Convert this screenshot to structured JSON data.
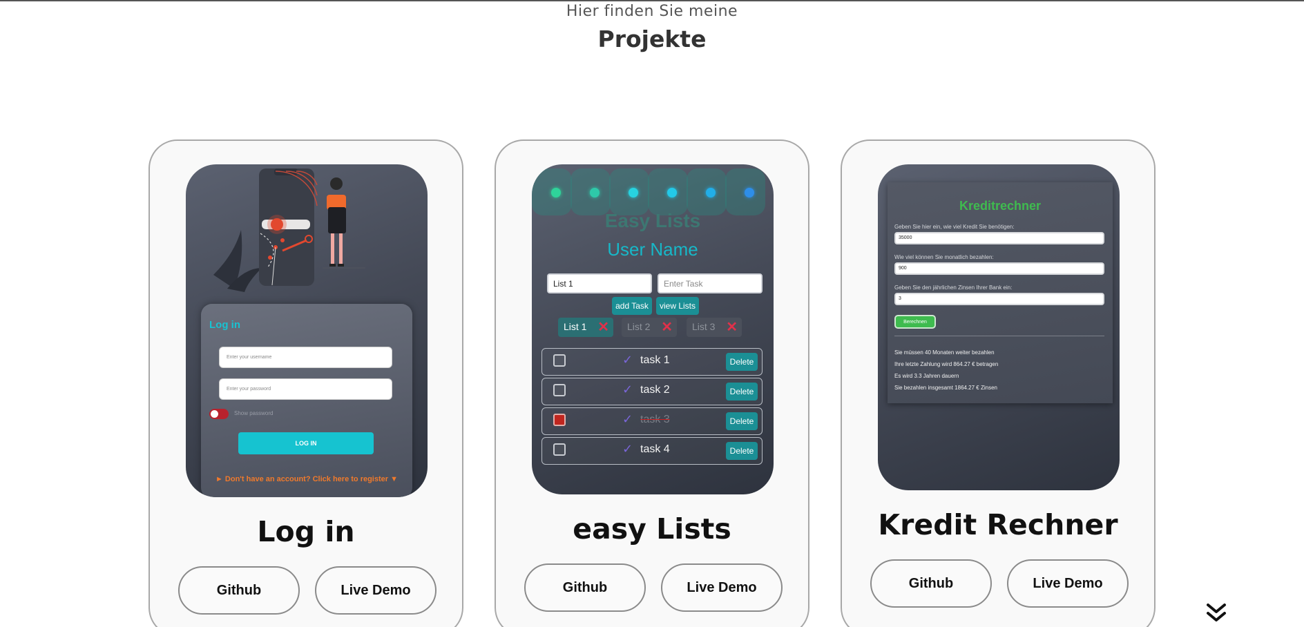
{
  "header": {
    "subtitle": "Hier finden Sie meine",
    "title": "Projekte"
  },
  "projects": [
    {
      "title": "Log in",
      "github_label": "Github",
      "demo_label": "Live Demo",
      "preview": {
        "heading": "Log in",
        "username_placeholder": "Enter your username",
        "password_placeholder": "Enter your password",
        "show_password_label": "Show password",
        "login_button": "LOG IN",
        "register_link": "► Don't have an account? Click here to register ▼"
      }
    },
    {
      "title": "easy Lists",
      "github_label": "Github",
      "demo_label": "Live Demo",
      "preview": {
        "app_title": "Easy Lists",
        "user_name": "User Name",
        "list_input_value": "List 1",
        "task_input_placeholder": "Enter Task",
        "add_task_button": "add Task",
        "view_lists_button": "view Lists",
        "lists": [
          "List 1",
          "List 2",
          "List 3"
        ],
        "tasks": [
          {
            "label": "task 1",
            "checked": false
          },
          {
            "label": "task 2",
            "checked": false
          },
          {
            "label": "task 3",
            "checked": true
          },
          {
            "label": "task 4",
            "checked": false
          }
        ],
        "delete_label": "Delete",
        "dot_colors": [
          "#2fd39a",
          "#2ec9a9",
          "#27d3e0",
          "#23c9e8",
          "#22aee8",
          "#2e8ee8"
        ]
      }
    },
    {
      "title": "Kredit Rechner",
      "github_label": "Github",
      "demo_label": "Live Demo",
      "preview": {
        "app_title": "Kreditrechner",
        "label_amount": "Geben Sie hier ein, wie viel Kredit Sie benötigen:",
        "value_amount": "35000",
        "label_monthly": "Wie viel können Sie monatlich bezahlen:",
        "value_monthly": "900",
        "label_interest": "Geben Sie den jährlichen Zinsen Ihrer Bank ein:",
        "value_interest": "3",
        "calc_button": "Berechnen",
        "results": [
          "Sie müssen 40 Monaten weiter bezahlen",
          "Ihre letzte Zahlung wird 864.27 € betragen",
          "Es wird 3.3 Jahren dauern",
          "Sie bezahlen insgesamt 1864.27 € Zinsen"
        ]
      }
    }
  ],
  "colors": {
    "accent_cyan": "#16c3d0",
    "accent_orange": "#f07a2c",
    "kredit_green": "#3fbb4f"
  },
  "icons": {
    "scroll_down": "double-chevron-down-icon"
  }
}
